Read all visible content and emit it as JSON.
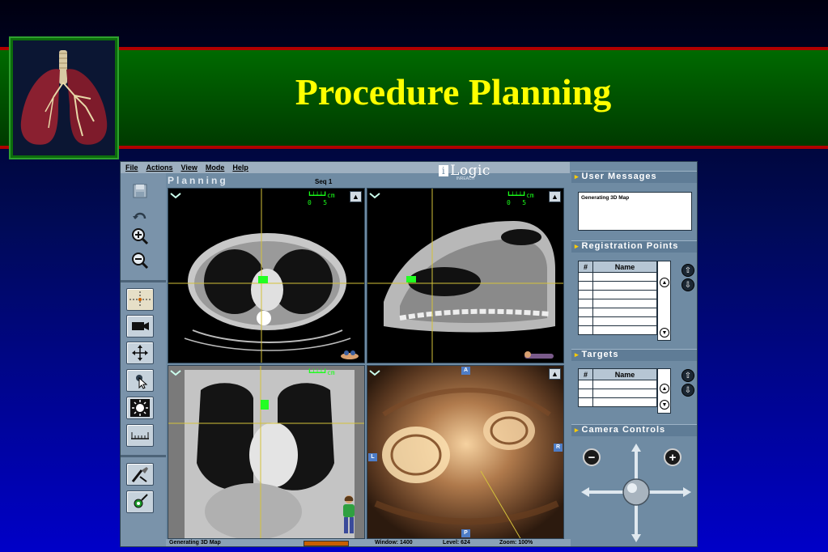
{
  "slide": {
    "title": "Procedure Planning"
  },
  "menu": [
    "File",
    "Actions",
    "View",
    "Mode",
    "Help"
  ],
  "brand": {
    "name": "Logic",
    "sub": "INREACH"
  },
  "mode_title": "Planning",
  "sequence": "Seq 1",
  "viewports": {
    "scale_label": "cm",
    "scale_min": "0",
    "scale_max": "5",
    "orientation": {
      "top": "A",
      "bottom": "P",
      "left": "L",
      "right": "R"
    }
  },
  "status": {
    "message": "Generating 3D Map",
    "window": "Window: 1400",
    "level": "Level: 624",
    "zoom": "Zoom: 100%"
  },
  "panels": {
    "user_messages": {
      "title": "User Messages",
      "text": "Generating 3D Map"
    },
    "registration_points": {
      "title": "Registration Points",
      "col_num": "#",
      "col_name": "Name"
    },
    "targets": {
      "title": "Targets",
      "col_num": "#",
      "col_name": "Name"
    },
    "camera_controls": {
      "title": "Camera Controls",
      "minus": "−",
      "plus": "+"
    }
  },
  "icons": [
    "save-icon",
    "undo-icon",
    "zoom-in-icon",
    "zoom-out-icon",
    "crosshair-icon",
    "camera-icon",
    "pan-icon",
    "pointer-icon",
    "brightness-icon",
    "ruler-icon",
    "pick-tool-icon",
    "target-tool-icon"
  ],
  "colors": {
    "title": "#ffff00",
    "band": "#005200",
    "band_border": "#b00000",
    "marker": "#22ff22",
    "crosshair": "#d4c23a"
  }
}
